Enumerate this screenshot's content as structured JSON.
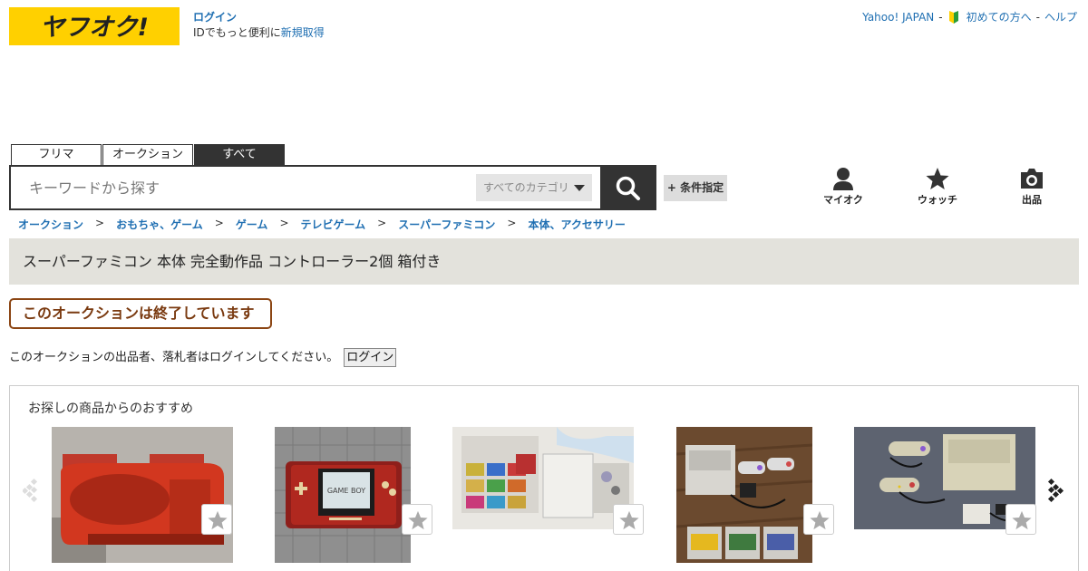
{
  "header": {
    "logo_text": "ヤフオク!",
    "login_label": "ログイン",
    "login_sub_text": "IDでもっと便利に",
    "signup_label": "新規取得",
    "util_links": [
      "Yahoo! JAPAN",
      "初めての方へ",
      "ヘルプ"
    ],
    "util_separator": "-"
  },
  "search": {
    "tabs": [
      {
        "label": "フリマ",
        "active": false
      },
      {
        "label": "オークション",
        "active": false
      },
      {
        "label": "すべて",
        "active": true
      }
    ],
    "placeholder": "キーワードから探す",
    "category_label": "すべてのカテゴリ",
    "condition_label": "+ 条件指定"
  },
  "icon_nav": [
    {
      "label": "マイオク",
      "icon": "person-icon"
    },
    {
      "label": "ウォッチ",
      "icon": "star-icon"
    },
    {
      "label": "出品",
      "icon": "camera-icon"
    }
  ],
  "breadcrumb": [
    "オークション",
    "おもちゃ、ゲーム",
    "ゲーム",
    "テレビゲーム",
    "スーパーファミコン",
    "本体、アクセサリー"
  ],
  "breadcrumb_separator": ">",
  "item": {
    "title": "スーパーファミコン 本体 完全動作品 コントローラー2個 箱付き",
    "status_badge": "このオークションは終了しています",
    "notice_text": "このオークションの出品者、落札者はログインしてください。",
    "notice_login_label": "ログイン"
  },
  "recommendations": {
    "title": "お探しの商品からのおすすめ",
    "item_images": [
      "red-console-photo",
      "gameboy-micro-photo",
      "famicom-cartridges-photo",
      "super-famicom-set-photo",
      "super-famicom-controllers-photo"
    ]
  },
  "colors": {
    "brand_yellow": "#ffd000",
    "link_blue": "#1f6fb2",
    "dark": "#333333",
    "ended_brown": "#8b4513"
  }
}
